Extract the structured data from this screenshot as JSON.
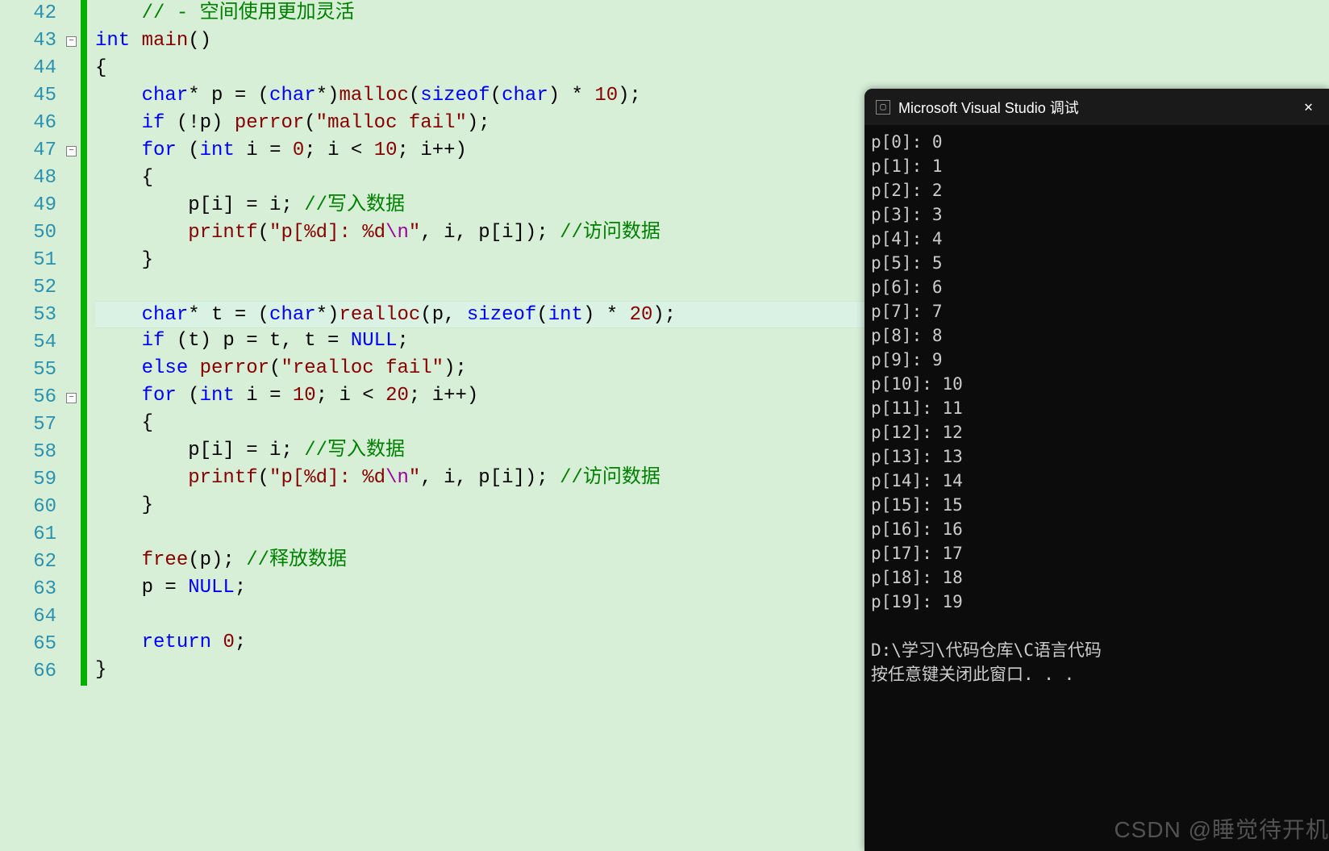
{
  "gutter": {
    "start": 42,
    "end": 66
  },
  "fold_buttons": [
    {
      "line": 43,
      "glyph": "−"
    },
    {
      "line": 47,
      "glyph": "−"
    },
    {
      "line": 56,
      "glyph": "−"
    }
  ],
  "highlight_line": 53,
  "code": {
    "42": [
      {
        "t": "    ",
        "c": "txt"
      },
      {
        "t": "// - 空间使用更加灵活",
        "c": "cm"
      }
    ],
    "43": [
      {
        "t": "int",
        "c": "kw"
      },
      {
        "t": " ",
        "c": "txt"
      },
      {
        "t": "main",
        "c": "fn"
      },
      {
        "t": "()",
        "c": "txt"
      }
    ],
    "44": [
      {
        "t": "{",
        "c": "txt"
      }
    ],
    "45": [
      {
        "t": "    ",
        "c": "txt"
      },
      {
        "t": "char",
        "c": "kw"
      },
      {
        "t": "* p = (",
        "c": "txt"
      },
      {
        "t": "char",
        "c": "kw"
      },
      {
        "t": "*)",
        "c": "txt"
      },
      {
        "t": "malloc",
        "c": "fn"
      },
      {
        "t": "(",
        "c": "txt"
      },
      {
        "t": "sizeof",
        "c": "kw"
      },
      {
        "t": "(",
        "c": "txt"
      },
      {
        "t": "char",
        "c": "kw"
      },
      {
        "t": ") * ",
        "c": "txt"
      },
      {
        "t": "10",
        "c": "num"
      },
      {
        "t": ");",
        "c": "txt"
      }
    ],
    "46": [
      {
        "t": "    ",
        "c": "txt"
      },
      {
        "t": "if",
        "c": "kw"
      },
      {
        "t": " (!p) ",
        "c": "txt"
      },
      {
        "t": "perror",
        "c": "fn"
      },
      {
        "t": "(",
        "c": "txt"
      },
      {
        "t": "\"malloc fail\"",
        "c": "str"
      },
      {
        "t": ");",
        "c": "txt"
      }
    ],
    "47": [
      {
        "t": "    ",
        "c": "txt"
      },
      {
        "t": "for",
        "c": "kw"
      },
      {
        "t": " (",
        "c": "txt"
      },
      {
        "t": "int",
        "c": "kw"
      },
      {
        "t": " i = ",
        "c": "txt"
      },
      {
        "t": "0",
        "c": "num"
      },
      {
        "t": "; i < ",
        "c": "txt"
      },
      {
        "t": "10",
        "c": "num"
      },
      {
        "t": "; i++)",
        "c": "txt"
      }
    ],
    "48": [
      {
        "t": "    {",
        "c": "txt"
      }
    ],
    "49": [
      {
        "t": "        p[i] = i; ",
        "c": "txt"
      },
      {
        "t": "//写入数据",
        "c": "cm"
      }
    ],
    "50": [
      {
        "t": "        ",
        "c": "txt"
      },
      {
        "t": "printf",
        "c": "fn"
      },
      {
        "t": "(",
        "c": "txt"
      },
      {
        "t": "\"p[%d]: %d",
        "c": "str"
      },
      {
        "t": "\\n",
        "c": "esc"
      },
      {
        "t": "\"",
        "c": "str"
      },
      {
        "t": ", i, p[i]); ",
        "c": "txt"
      },
      {
        "t": "//访问数据",
        "c": "cm"
      }
    ],
    "51": [
      {
        "t": "    }",
        "c": "txt"
      }
    ],
    "52": [
      {
        "t": "",
        "c": "txt"
      }
    ],
    "53": [
      {
        "t": "    ",
        "c": "txt"
      },
      {
        "t": "char",
        "c": "kw"
      },
      {
        "t": "* t = (",
        "c": "txt"
      },
      {
        "t": "char",
        "c": "kw"
      },
      {
        "t": "*)",
        "c": "txt"
      },
      {
        "t": "realloc",
        "c": "fn"
      },
      {
        "t": "(p, ",
        "c": "txt"
      },
      {
        "t": "sizeof",
        "c": "kw"
      },
      {
        "t": "(",
        "c": "txt"
      },
      {
        "t": "int",
        "c": "kw"
      },
      {
        "t": ") * ",
        "c": "txt"
      },
      {
        "t": "20",
        "c": "num"
      },
      {
        "t": ");",
        "c": "txt"
      }
    ],
    "54": [
      {
        "t": "    ",
        "c": "txt"
      },
      {
        "t": "if",
        "c": "kw"
      },
      {
        "t": " (t) p = t, t = ",
        "c": "txt"
      },
      {
        "t": "NULL",
        "c": "kw"
      },
      {
        "t": ";",
        "c": "txt"
      }
    ],
    "55": [
      {
        "t": "    ",
        "c": "txt"
      },
      {
        "t": "else",
        "c": "kw"
      },
      {
        "t": " ",
        "c": "txt"
      },
      {
        "t": "perror",
        "c": "fn"
      },
      {
        "t": "(",
        "c": "txt"
      },
      {
        "t": "\"realloc fail\"",
        "c": "str"
      },
      {
        "t": ");",
        "c": "txt"
      }
    ],
    "56": [
      {
        "t": "    ",
        "c": "txt"
      },
      {
        "t": "for",
        "c": "kw"
      },
      {
        "t": " (",
        "c": "txt"
      },
      {
        "t": "int",
        "c": "kw"
      },
      {
        "t": " i = ",
        "c": "txt"
      },
      {
        "t": "10",
        "c": "num"
      },
      {
        "t": "; i < ",
        "c": "txt"
      },
      {
        "t": "20",
        "c": "num"
      },
      {
        "t": "; i++)",
        "c": "txt"
      }
    ],
    "57": [
      {
        "t": "    {",
        "c": "txt"
      }
    ],
    "58": [
      {
        "t": "        p[i] = i; ",
        "c": "txt"
      },
      {
        "t": "//写入数据",
        "c": "cm"
      }
    ],
    "59": [
      {
        "t": "        ",
        "c": "txt"
      },
      {
        "t": "printf",
        "c": "fn"
      },
      {
        "t": "(",
        "c": "txt"
      },
      {
        "t": "\"p[%d]: %d",
        "c": "str"
      },
      {
        "t": "\\n",
        "c": "esc"
      },
      {
        "t": "\"",
        "c": "str"
      },
      {
        "t": ", i, p[i]); ",
        "c": "txt"
      },
      {
        "t": "//访问数据",
        "c": "cm"
      }
    ],
    "60": [
      {
        "t": "    }",
        "c": "txt"
      }
    ],
    "61": [
      {
        "t": "",
        "c": "txt"
      }
    ],
    "62": [
      {
        "t": "    ",
        "c": "txt"
      },
      {
        "t": "free",
        "c": "fn"
      },
      {
        "t": "(p); ",
        "c": "txt"
      },
      {
        "t": "//释放数据",
        "c": "cm"
      }
    ],
    "63": [
      {
        "t": "    p = ",
        "c": "txt"
      },
      {
        "t": "NULL",
        "c": "kw"
      },
      {
        "t": ";",
        "c": "txt"
      }
    ],
    "64": [
      {
        "t": "",
        "c": "txt"
      }
    ],
    "65": [
      {
        "t": "    ",
        "c": "txt"
      },
      {
        "t": "return",
        "c": "kw"
      },
      {
        "t": " ",
        "c": "txt"
      },
      {
        "t": "0",
        "c": "num"
      },
      {
        "t": ";",
        "c": "txt"
      }
    ],
    "66": [
      {
        "t": "}",
        "c": "txt"
      }
    ]
  },
  "console": {
    "title": "Microsoft Visual Studio 调试",
    "output": [
      "p[0]: 0",
      "p[1]: 1",
      "p[2]: 2",
      "p[3]: 3",
      "p[4]: 4",
      "p[5]: 5",
      "p[6]: 6",
      "p[7]: 7",
      "p[8]: 8",
      "p[9]: 9",
      "p[10]: 10",
      "p[11]: 11",
      "p[12]: 12",
      "p[13]: 13",
      "p[14]: 14",
      "p[15]: 15",
      "p[16]: 16",
      "p[17]: 17",
      "p[18]: 18",
      "p[19]: 19",
      "",
      "D:\\学习\\代码仓库\\C语言代码",
      "按任意键关闭此窗口. . ."
    ]
  },
  "watermark": "CSDN @睡觉待开机"
}
